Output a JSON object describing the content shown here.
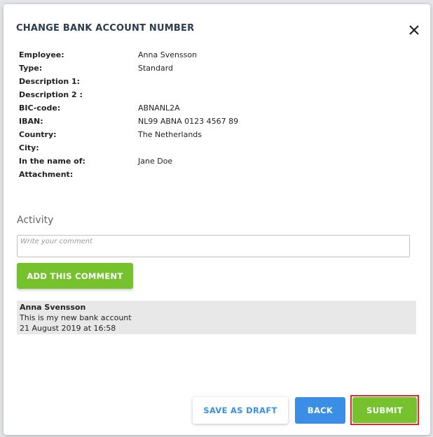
{
  "dialog": {
    "title": "CHANGE BANK ACCOUNT NUMBER",
    "close_icon": "close-icon"
  },
  "details": [
    {
      "label": "Employee:",
      "value": "Anna Svensson"
    },
    {
      "label": "Type:",
      "value": "Standard"
    },
    {
      "label": "Description 1:",
      "value": ""
    },
    {
      "label": "Description 2 :",
      "value": ""
    },
    {
      "label": "BIC-code:",
      "value": "ABNANL2A"
    },
    {
      "label": "IBAN:",
      "value": "NL99 ABNA 0123 4567 89"
    },
    {
      "label": "Country:",
      "value": "The Netherlands"
    },
    {
      "label": "City:",
      "value": ""
    },
    {
      "label": "In the name of:",
      "value": "Jane Doe"
    },
    {
      "label": "Attachment:",
      "value": ""
    }
  ],
  "activity": {
    "heading": "Activity",
    "comment_placeholder": "Write your comment",
    "add_button": "ADD THIS COMMENT",
    "comments": [
      {
        "author": "Anna Svensson",
        "text": "This is my new bank account",
        "date": "21 August 2019 at 16:58"
      }
    ]
  },
  "footer": {
    "save_draft": "SAVE AS DRAFT",
    "back": "BACK",
    "submit": "SUBMIT"
  },
  "colors": {
    "accent_green": "#76c22e",
    "accent_blue": "#3a8ee6",
    "highlight_red": "#e8262a"
  }
}
